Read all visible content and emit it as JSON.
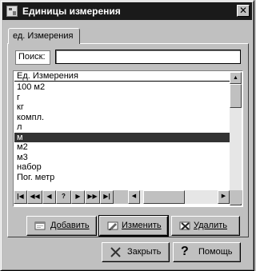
{
  "window": {
    "title": "Единицы измерения",
    "close_glyph": "✕"
  },
  "tab": {
    "label": "ед. Измерения"
  },
  "search": {
    "label": "Поиск:",
    "value": "",
    "placeholder": ""
  },
  "grid": {
    "column_header": "Ед. Измерения",
    "rows": [
      "100 м2",
      "г",
      "кг",
      "компл.",
      "л",
      "м",
      "м2",
      "м3",
      "набор",
      "Пог. метр"
    ],
    "selected_row": "м"
  },
  "navigator": {
    "first": "|◀",
    "prev_page": "◀◀",
    "prev": "◀",
    "help": "?",
    "next": "▶",
    "next_page": "▶▶",
    "last": "▶|"
  },
  "scrollbars": {
    "up": "▲",
    "down": "▼",
    "left": "◀",
    "right": "▶"
  },
  "actions": {
    "add_label": "Добавить",
    "edit_label": "Изменить",
    "delete_label": "Удалить"
  },
  "footer": {
    "close_label": "Закрыть",
    "help_label": "Помощь",
    "help_glyph": "?"
  },
  "icons": {
    "title": "window-app-icon",
    "add": "add-record-icon",
    "edit": "edit-record-icon",
    "delete": "delete-record-icon",
    "close": "x-icon",
    "help": "question-icon"
  },
  "colors": {
    "titlebar": "#1a1a1a",
    "selection": "#333333",
    "face": "#c0c0c0"
  }
}
